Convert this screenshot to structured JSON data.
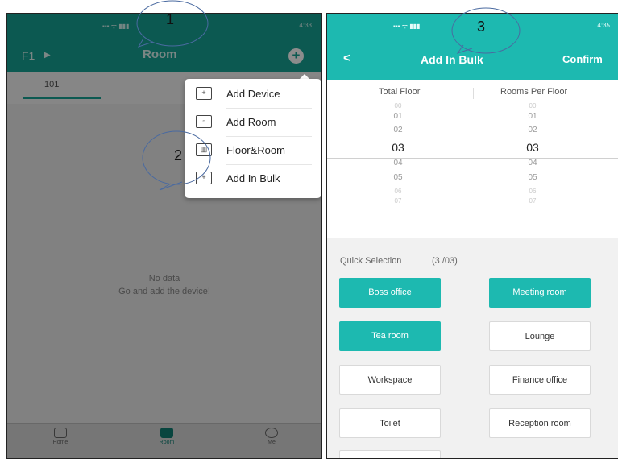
{
  "left_screen": {
    "status_time": "4:33",
    "status_icons": "▪▪▪ ᯤ ▮▮▮",
    "floor_label": "F1",
    "floor_arrow": "▶",
    "title": "Room",
    "add_icon": "plus-circle-icon",
    "tabs": [
      {
        "label": "101"
      }
    ],
    "empty": {
      "line1": "No data",
      "line2": "Go and add the device!"
    },
    "menu": [
      {
        "label": "Add Device",
        "icon": "add-device-icon",
        "glyph": "+"
      },
      {
        "label": "Add Room",
        "icon": "add-room-icon",
        "glyph": "▫"
      },
      {
        "label": "Floor&Room",
        "icon": "floor-room-icon",
        "glyph": "▥"
      },
      {
        "label": "Add In Bulk",
        "icon": "add-in-bulk-icon",
        "glyph": "+"
      }
    ],
    "nav": [
      {
        "label": "Home",
        "icon": "home-icon"
      },
      {
        "label": "Room",
        "icon": "room-icon"
      },
      {
        "label": "Me",
        "icon": "profile-icon"
      }
    ]
  },
  "right_screen": {
    "status_time": "4:35",
    "status_icons": "▪▪▪ ᯤ ▮▮▮",
    "back": "<",
    "title": "Add In Bulk",
    "confirm": "Confirm",
    "picker": {
      "headers": [
        "Total Floor",
        "Rooms Per Floor"
      ],
      "values": [
        "00",
        "01",
        "02",
        "03",
        "04",
        "05",
        "06",
        "07"
      ],
      "selected_left": "03",
      "selected_right": "03"
    },
    "quick": {
      "label": "Quick Selection",
      "count": "(3 /03)"
    },
    "rooms": [
      {
        "label": "Boss office",
        "selected": true
      },
      {
        "label": "Meeting room",
        "selected": true
      },
      {
        "label": "Tea room",
        "selected": true
      },
      {
        "label": "Lounge",
        "selected": false
      },
      {
        "label": "Workspace",
        "selected": false
      },
      {
        "label": "Finance office",
        "selected": false
      },
      {
        "label": "Toilet",
        "selected": false
      },
      {
        "label": "Reception room",
        "selected": false
      },
      {
        "label": "",
        "selected": false
      }
    ]
  },
  "callouts": [
    "1",
    "2",
    "3"
  ],
  "colors": {
    "teal_dark": "#16a394",
    "teal": "#1db9b0"
  }
}
